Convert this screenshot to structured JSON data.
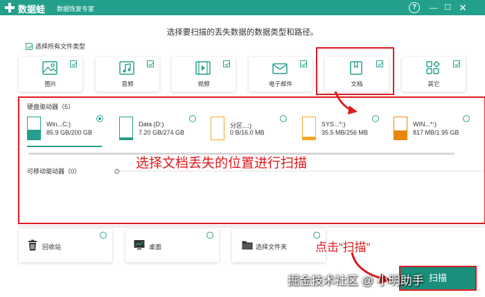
{
  "app": {
    "brand": "数据蛙",
    "subtitle": "数据恢复专家",
    "help_label": "?",
    "minimize_label": "—",
    "maximize_label": "☐",
    "close_label": "✕"
  },
  "headline": "选择要扫描的丢失数据的数据类型和路径。",
  "select_all": {
    "label": "选择所有文件类型",
    "checked": true
  },
  "file_types": [
    {
      "label": "图片",
      "icon": "image-icon",
      "checked": true
    },
    {
      "label": "音频",
      "icon": "music-icon",
      "checked": true
    },
    {
      "label": "视频",
      "icon": "video-icon",
      "checked": true
    },
    {
      "label": "电子邮件",
      "icon": "email-icon",
      "checked": true
    },
    {
      "label": "文档",
      "icon": "document-icon",
      "checked": true
    },
    {
      "label": "其它",
      "icon": "other-icon",
      "checked": true
    }
  ],
  "hard_drives": {
    "title": "硬盘驱动器（5）",
    "items": [
      {
        "name": "Win...C:)",
        "size": "85.9 GB/200 GB",
        "used_fraction": 0.43,
        "color": "#23a08b",
        "selected": true
      },
      {
        "name": "Data (D:)",
        "size": "7.20 GB/274 GB",
        "used_fraction": 0.03,
        "color": "#23a08b",
        "selected": false
      },
      {
        "name": "分区...:)",
        "size": "0 B/16.0 MB",
        "used_fraction": 0.0,
        "color": "#f5a623",
        "selected": false
      },
      {
        "name": "SYS...*:)",
        "size": "35.5 MB/256 MB",
        "used_fraction": 0.14,
        "color": "#f5a623",
        "selected": false
      },
      {
        "name": "WIN...*:)",
        "size": "817 MB/1.95 GB",
        "used_fraction": 0.42,
        "color": "#e8850c",
        "selected": false
      }
    ]
  },
  "removable_drives": {
    "title": "可移动驱动器（0）"
  },
  "locations": [
    {
      "label": "回收站",
      "icon": "recycle-bin-icon"
    },
    {
      "label": "桌面",
      "icon": "desktop-icon"
    },
    {
      "label": "选择文件夹",
      "icon": "folder-icon"
    }
  ],
  "annotations": {
    "location_hint": "选择文档丢失的位置进行扫描",
    "scan_hint": "点击“扫描”"
  },
  "scan_button": {
    "label": "扫描"
  },
  "watermark": "掘金技术社区 @ 小明助手",
  "colors": {
    "accent": "#23a08b",
    "annotation": "#e0191e"
  }
}
